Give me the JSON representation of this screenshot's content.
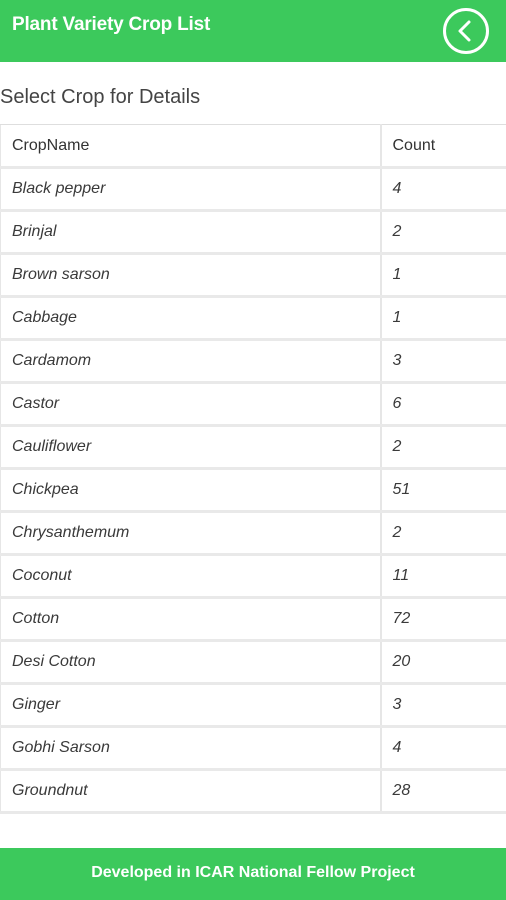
{
  "header": {
    "title": "Plant Variety Crop List",
    "back_icon": "chevron-left-icon"
  },
  "section_title": "Select Crop for Details",
  "table": {
    "columns": [
      "CropName",
      "Count"
    ],
    "rows": [
      {
        "name": "Black pepper",
        "count": "4"
      },
      {
        "name": "Brinjal",
        "count": "2"
      },
      {
        "name": "Brown sarson",
        "count": "1"
      },
      {
        "name": "Cabbage",
        "count": "1"
      },
      {
        "name": "Cardamom",
        "count": "3"
      },
      {
        "name": "Castor",
        "count": "6"
      },
      {
        "name": "Cauliflower",
        "count": "2"
      },
      {
        "name": "Chickpea",
        "count": "51"
      },
      {
        "name": "Chrysanthemum",
        "count": "2"
      },
      {
        "name": "Coconut",
        "count": "11"
      },
      {
        "name": "Cotton",
        "count": "72"
      },
      {
        "name": "Desi Cotton",
        "count": "20"
      },
      {
        "name": "Ginger",
        "count": "3"
      },
      {
        "name": "Gobhi Sarson",
        "count": "4"
      },
      {
        "name": "Groundnut",
        "count": "28"
      }
    ]
  },
  "footer": {
    "text": "Developed in ICAR National Fellow Project"
  },
  "colors": {
    "accent": "#3cc95c",
    "text": "#333333",
    "border": "#e6e6e6"
  }
}
